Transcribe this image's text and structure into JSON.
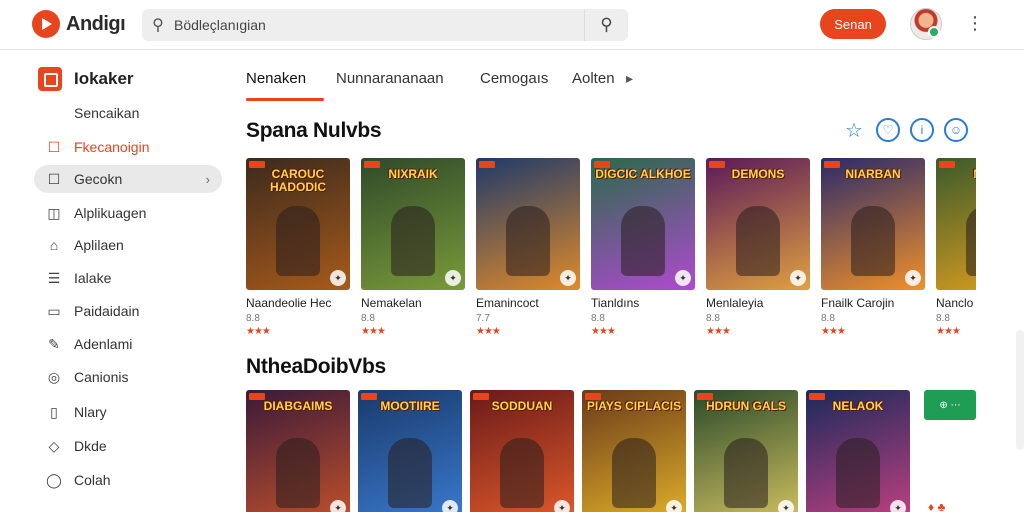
{
  "app": {
    "logo_text": "Andigı"
  },
  "search": {
    "value": "Bödleçlanıgian"
  },
  "header": {
    "signin_label": "Senan"
  },
  "sidebar": {
    "title": "Iokaker",
    "subtitle": "Sencaikan",
    "items": [
      {
        "label": "Fkecanoigin",
        "icon": "☐",
        "icon_name": "tag-icon"
      },
      {
        "label": "Gecokn",
        "icon": "☐",
        "icon_name": "folder-icon"
      },
      {
        "label": "Alplikuagen",
        "icon": "◫",
        "icon_name": "apps-icon"
      },
      {
        "label": "Aplilaen",
        "icon": "⌂",
        "icon_name": "lock-icon"
      },
      {
        "label": "Ialake",
        "icon": "☰",
        "icon_name": "list-icon"
      },
      {
        "label": "Paidaidain",
        "icon": "▭",
        "icon_name": "card-icon"
      },
      {
        "label": "Adenlami",
        "icon": "✎",
        "icon_name": "pen-icon"
      },
      {
        "label": "Canionis",
        "icon": "◎",
        "icon_name": "disc-icon"
      },
      {
        "label": "Nlary",
        "icon": "▯",
        "icon_name": "page-icon"
      },
      {
        "label": "Dkde",
        "icon": "◇",
        "icon_name": "diamond-icon"
      },
      {
        "label": "Colah",
        "icon": "◯",
        "icon_name": "circle-icon"
      }
    ]
  },
  "tabs": [
    {
      "label": "Nenaken"
    },
    {
      "label": "Nunnarananaan"
    },
    {
      "label": "Cemogaıs"
    },
    {
      "label": "Aolten"
    }
  ],
  "sections": [
    {
      "title": "Spana Nulvbs",
      "cards": [
        {
          "art_title": "CAROUC HADODIC",
          "name": "Naandeolie Hec",
          "meta": "8.8",
          "rating": "★★★",
          "colors": [
            "#3b2a1e",
            "#a85a1a"
          ]
        },
        {
          "art_title": "NIXRAIK",
          "name": "Nemakelan",
          "meta": "8.8",
          "rating": "★★★",
          "colors": [
            "#2f4a2a",
            "#7a9a3a"
          ]
        },
        {
          "art_title": "",
          "name": "Emanincoct",
          "meta": "7.7",
          "rating": "★★★",
          "colors": [
            "#1e3a6a",
            "#e08a2a"
          ]
        },
        {
          "art_title": "DIGCIC ALKHOE",
          "name": "Tianldıns",
          "meta": "8.8",
          "rating": "★★★",
          "colors": [
            "#2a6a4a",
            "#b04ad0"
          ]
        },
        {
          "art_title": "DEMONS",
          "name": "Menlaleyia",
          "meta": "8.8",
          "rating": "★★★",
          "colors": [
            "#5a1a5a",
            "#e0a040"
          ]
        },
        {
          "art_title": "NIARBAN",
          "name": "Fnailk Carojin",
          "meta": "8.8",
          "rating": "★★★",
          "colors": [
            "#2a2a6a",
            "#f0902a"
          ]
        },
        {
          "art_title": "NIAR",
          "name": "Nanclo",
          "meta": "8.8",
          "rating": "★★★",
          "colors": [
            "#3a5a2a",
            "#e0a020"
          ]
        }
      ]
    },
    {
      "title": "NtheaDoibVbs",
      "chip": "⊕ ⋯",
      "cards": [
        {
          "art_title": "DIABGAIMS",
          "colors": [
            "#3a1a3a",
            "#c0502a"
          ]
        },
        {
          "art_title": "MOOTIIRE",
          "colors": [
            "#1a3a6a",
            "#3a7ad0"
          ]
        },
        {
          "art_title": "SODDUAN",
          "colors": [
            "#6a1a1a",
            "#e05a2a"
          ]
        },
        {
          "art_title": "PIAYS CIPLACIS",
          "colors": [
            "#6a3a1a",
            "#e0b02a"
          ]
        },
        {
          "art_title": "HDRUN GALS",
          "colors": [
            "#2a4a2a",
            "#d0c060"
          ]
        },
        {
          "art_title": "NELAOK",
          "colors": [
            "#1a2a5a",
            "#c04080"
          ]
        }
      ]
    }
  ]
}
